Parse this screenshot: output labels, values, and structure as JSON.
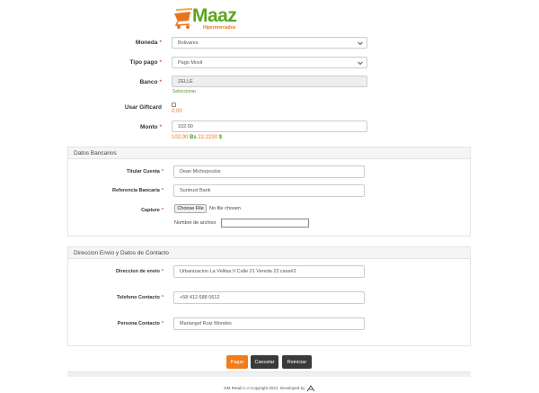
{
  "brand": {
    "name": "Maaz",
    "subtitle": "Hipermercados"
  },
  "form": {
    "moneda": {
      "label": "Moneda",
      "req": "*",
      "value": "Bolivares"
    },
    "tipo_pago": {
      "label": "Tipo pago",
      "req": "*",
      "value": "Pago Movil"
    },
    "banco": {
      "label": "Banco",
      "req": "*",
      "value": "ZELLE",
      "link": "Seleccionar"
    },
    "giftcard": {
      "label": "Usar Giftcard",
      "amount": "0.00"
    },
    "monto": {
      "label": "Monto",
      "req": "*",
      "value": "102.00",
      "amount": "102.00",
      "bs_label": "Bs",
      "bs_value": "22.2230",
      "bs_suffix": "$"
    }
  },
  "datos_bancarios": {
    "title": "Datos Bancarios",
    "titular": {
      "label": "Titular Cuenta",
      "req": "*",
      "value": "Dean Michopoulos"
    },
    "referencia": {
      "label": "Referencia Bancaria",
      "req": "*",
      "value": "Suntrust Bank"
    },
    "capture": {
      "label": "Capture",
      "req": "*",
      "button": "Choose File",
      "status": "No file chosen"
    },
    "nombre_archivo": {
      "label": "Nombre de archivo",
      "value": ""
    }
  },
  "direccion": {
    "title": "Direccion Envio y Datos de Contacto",
    "envio": {
      "label": "Direccion de envio",
      "req": "*",
      "value": "Urbanizacion La Velitas II Calle 21 Vereda 22 casa#2"
    },
    "telefono": {
      "label": "Telefono Contacto",
      "req": "*",
      "value": "+58 412 688 0612"
    },
    "persona": {
      "label": "Persona Contacto",
      "req": "*",
      "value": "Mariangel Ruiz Morales"
    }
  },
  "actions": {
    "pagar": "Pagar",
    "cancelar": "Cancelar",
    "reiniciar": "Reiniciar"
  },
  "footer": {
    "text": "DM Retail C.A Copyright 2021. Developed by"
  },
  "colors": {
    "accent": "#f07c1c",
    "brand_green": "#5aa51e",
    "dark_button": "#3a3a3a"
  }
}
